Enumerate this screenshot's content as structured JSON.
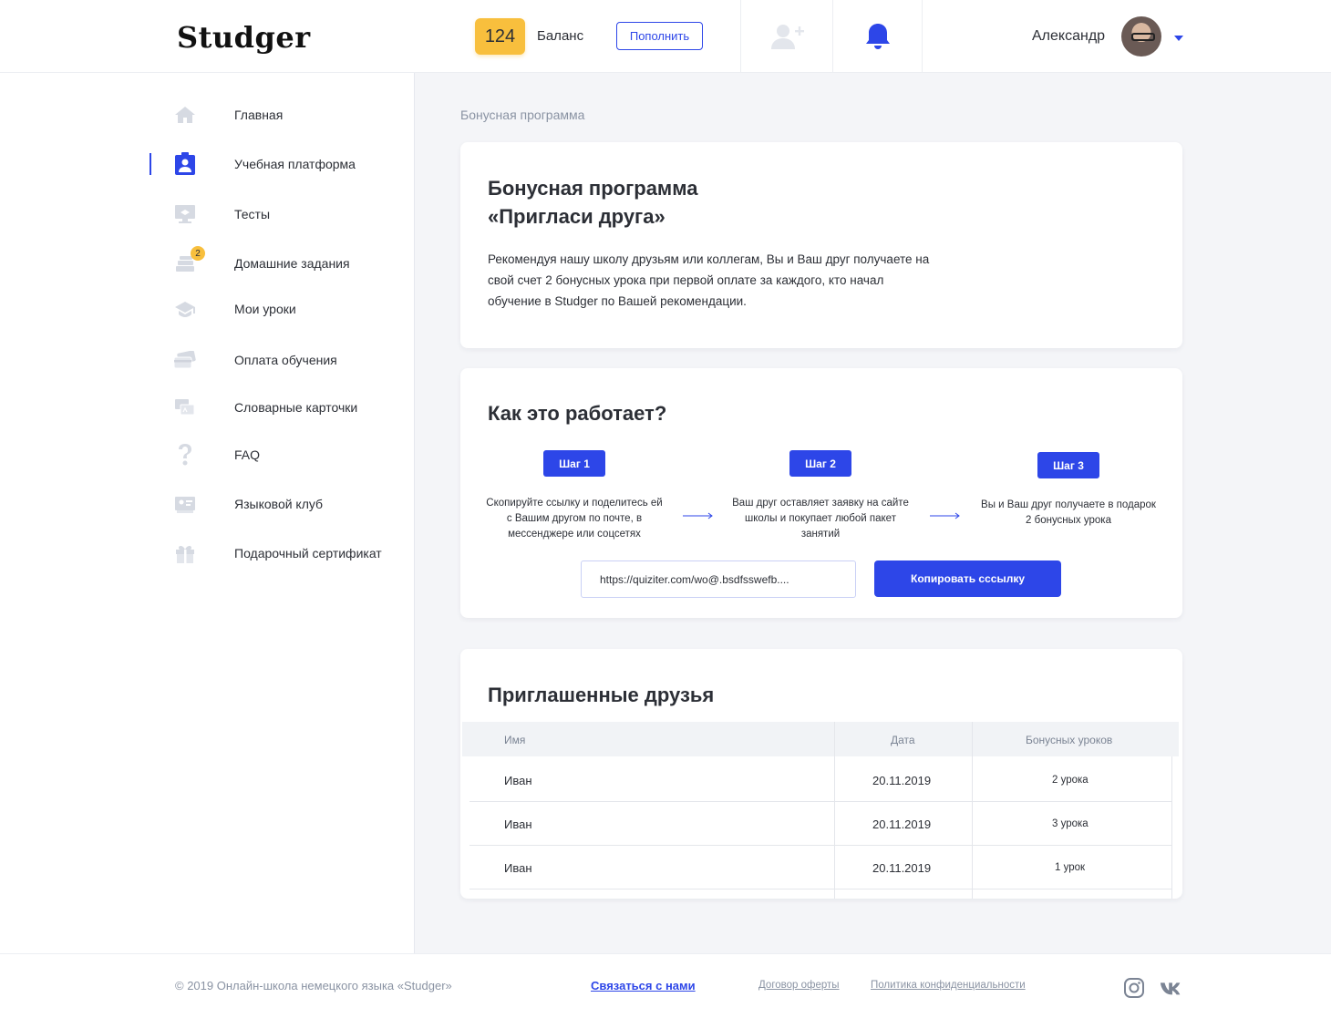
{
  "header": {
    "logo": "Studger",
    "balance_value": "124",
    "balance_label": "Баланс",
    "topup_label": "Пополнить",
    "user_name": "Александр"
  },
  "sidebar": {
    "items": [
      {
        "label": "Главная",
        "icon": "home-icon"
      },
      {
        "label": "Учебная платформа",
        "icon": "badge-icon",
        "active": true
      },
      {
        "label": "Тесты",
        "icon": "monitor-icon"
      },
      {
        "label": "Домашние задания",
        "icon": "books-icon",
        "badge": "2"
      },
      {
        "label": "Мои уроки",
        "icon": "graduation-cap-icon"
      },
      {
        "label": "Оплата обучения",
        "icon": "credit-card-icon"
      },
      {
        "label": "Словарные карточки",
        "icon": "cards-icon"
      },
      {
        "label": "FAQ",
        "icon": "question-icon"
      },
      {
        "label": "Языковой клуб",
        "icon": "club-icon"
      },
      {
        "label": "Подарочный сертификат",
        "icon": "gift-icon"
      }
    ]
  },
  "main": {
    "breadcrumb": "Бонусная программа",
    "intro": {
      "title_line1": "Бонусная программа",
      "title_line2": "«Пригласи друга»",
      "description": "Рекомендуя нашу школу друзьям или коллегам, Вы и Ваш друг получаете на свой счет 2 бонусных урока при первой оплате за каждого, кто начал обучение в Studger по Вашей рекомендации."
    },
    "how": {
      "title": "Как это работает?",
      "steps": [
        {
          "label": "Шаг 1",
          "text": "Скопируйте ссылку и поделитесь ей с Вашим другом по почте, в мессенджере или соцсетях"
        },
        {
          "label": "Шаг 2",
          "text": "Ваш друг оставляет заявку на сайте школы и покупает любой пакет занятий"
        },
        {
          "label": "Шаг 3",
          "text": "Вы и Ваш друг получаете в подарок 2 бонусных урока"
        }
      ],
      "link_value": "https://quiziter.com/wo@.bsdfsswefb....",
      "copy_label": "Копировать сссылку"
    },
    "friends": {
      "title": "Приглашенные друзья",
      "columns": [
        "Имя",
        "Дата",
        "Бонусных уроков"
      ],
      "rows": [
        {
          "name": "Иван",
          "date": "20.11.2019",
          "bonus": "2 урока"
        },
        {
          "name": "Иван",
          "date": "20.11.2019",
          "bonus": "3 урока"
        },
        {
          "name": "Иван",
          "date": "20.11.2019",
          "bonus": "1 урок"
        }
      ]
    }
  },
  "footer": {
    "copyright": "© 2019 Онлайн-школа немецкого языка «Studger»",
    "contact": "Связаться с нами",
    "offer": "Договор оферты",
    "privacy": "Политика конфиденциальности",
    "social": [
      "instagram-icon",
      "vk-icon"
    ]
  },
  "colors": {
    "accent": "#2d46e8",
    "balance": "#f8bf3d",
    "muted": "#8a93a3",
    "background": "#f4f5f8"
  }
}
